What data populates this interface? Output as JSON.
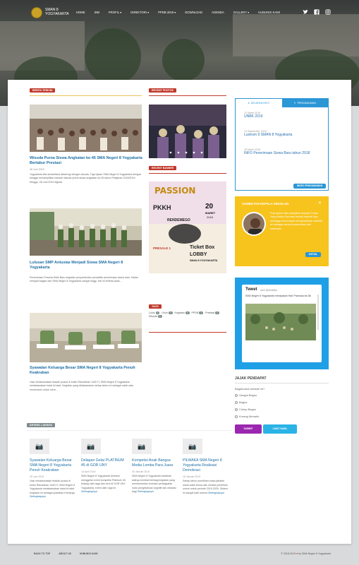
{
  "header": {
    "brand_line1": "SMAN 8",
    "brand_line2": "YOGYAKARTA",
    "menu": [
      "HOME",
      "SIM",
      "PROFIL ▾",
      "DIREKTORI ▾",
      "PPDB 2019 ▾",
      "DOWNLOAD",
      "AGENDA",
      "GALLERY ▾",
      "HUBUNGI KAMI"
    ],
    "social_icons": [
      "twitter-icon",
      "facebook-icon",
      "instagram-icon"
    ]
  },
  "sections": {
    "berita": "BERITA TERKINI",
    "recent_photos": "RECENT PHOTOS",
    "recent_banner": "RECENT BANNER",
    "tags": "TAGS",
    "artikel": "ARTIKEL LAINNYA"
  },
  "posts": [
    {
      "title": "Wisuda Purna Siswa Angkatan ke-45 SMA Negeri 8 Yogyakarta Bertabur Prestasi",
      "meta": "08 Juni 2019",
      "excerpt": "Yogyakarta kita senantiasa dibarengi dengan wisuda. Tiga tujuan SMA Negeri 8 Yogyakarta dengan bangga menampilkan barisan wisuda purna siswa angkatan ke-45 tahun Pelajaran 2018/2019. Minggu, 28 Juni 2019 digelar."
    },
    {
      "title": "Lulusan SMP Antusias Menjadi Siswa SMA Negeri 8 Yogyakarta",
      "meta": "",
      "excerpt": "Penerimaan Peserta Didik Baru kegiatan penyambutan pendaftar penerimaan siswa baru. Kalian menjadi bagian dari SMA Negeri 8 Yogyakarta sangat tinggi. Hal ini terlihat pada..."
    },
    {
      "title": "Syawalan Keluarga Besar SMA Negeri 8 Yogyakarta Penuh Keakraban",
      "meta": "",
      "excerpt": "Usai melaksanakan ibadah puasa di bulan Ramadhan 1440 H, SMA Negeri 8 Yogyakarta melaksanakan halal bi halal. Kegiatan yang dilaksanakan setiap tahun ini sebagai salah satu momentum untuk mem..."
    }
  ],
  "tabbox": {
    "tab1": "DELAPAN INFO",
    "tab2": "PENGUMUMAN",
    "items": [
      {
        "date": "22 Maret 2019",
        "title": "UNBK 2019"
      },
      {
        "date": "14 September 2018",
        "title": "Lustrum 9 SMAN 8 Yogyakarta"
      },
      {
        "date": "28 Maret 2018",
        "title": "INFO Penerimaan Siswa Baru tahun 2018"
      }
    ],
    "more": "INDEX PENGUMUMAN"
  },
  "welcome": {
    "title": "SAMBUTAN KEPALA SEKOLAH",
    "close": "✕",
    "text": "Puji syukur kita panjatkan kepada Tuhan Yang Maha Esa atas berkat rahmat-Nya sehingga kami dapat menghadirkan website ini sebagai sarana komunikasi dan informasi...",
    "button": "DETAIL"
  },
  "tweet": {
    "label": "Tweet",
    "handle": "oleh @sma8yk",
    "text": "SMA Negeri 8 Yogyakarta merayakan Hari Pramuka ke-58"
  },
  "poll": {
    "title": "JAJAK PENDAPAT",
    "question": "Bagaimana website ini?",
    "options": [
      "Sangat Bagus",
      "Bagus",
      "Cukup Bagus",
      "Kurang Menarik"
    ],
    "vote": "SUBMIT",
    "results": "LIHAT HASIL"
  },
  "tags": [
    {
      "name": "Lulus",
      "count": "2"
    },
    {
      "name": "Ulum",
      "count": "3"
    },
    {
      "name": "Kegiatan",
      "count": "4"
    },
    {
      "name": "PPDB",
      "count": "1"
    },
    {
      "name": "Prestasi",
      "count": "2"
    },
    {
      "name": "Wisuda",
      "count": "1"
    }
  ],
  "banner": {
    "line1": "PASSION",
    "line2": "PKKH",
    "line3": "RENDEMEGO",
    "day": "20",
    "month": "MARET",
    "year": "2018",
    "presale": "PRESALE 1",
    "ticket": "Ticket Box",
    "lobby": "LOBBY",
    "venue": "SMAN 8 YOGYAKARTA"
  },
  "bottom_posts": [
    {
      "title": "Syawalan Keluarga Besar SMA Negeri 8 Yogyakarta Penuh Keakraban",
      "date": "28 Juni 2019",
      "excerpt": "Usai melaksanakan ibadah puasa di bulan Ramadhan 1440 H, SMA Negeri 8 Yogyakarta melaksanakan halal bi halal. Kegiatan ini sebagai syawalan Keluarga",
      "more": "Selengkapnya"
    },
    {
      "title": "Delapan Gelar PLATINUM 45 di GOR UNY",
      "date": "14 April 2019",
      "excerpt": "SMA Negeri 8 Yogyakarta berhasil menggelar event kompetisi Platinum 45 bidang olah raga dan seni di GOR UNY Yogyakarta, event olah raga ini",
      "more": "Selengkapnya"
    },
    {
      "title": "Kompetisi Anak Bangsa Media Lomba Para Juara",
      "date": "26 Januari 2019",
      "excerpt": "SMA Negeri 8 Yogyakarta kesekian kalinya kembali berbagi kegiatan yang membutuhkan tuntutan peningkatan mutu pengetahuan kognitif dan edukasi bagi",
      "more": "Selengkapnya"
    },
    {
      "title": "PILWAKA SMA Negeri 8 Yogyakarta Realisasi Demokrasi",
      "date": "18 Januari 2019",
      "excerpt": "Setiap tahun pemilihan masa jabatan untuk wakil ketua osis melalui pemilihan umum untuk periode 2019-2020. Sistem ini sangat baik karena",
      "more": "Selengkapnya"
    }
  ],
  "footer": {
    "links": [
      "BACK TO TOP",
      "ABOUT US",
      "HUBUNGI KAMI"
    ],
    "copy_prefix": "© 2018-2019",
    "heart": "♥",
    "copy_by": "by",
    "copy_suffix": "SMA Negeri 8 Yogyakarta"
  },
  "colors": {
    "accent_blue": "#2b97d5",
    "accent_red": "#c0392b",
    "welcome_yellow": "#f7c31d",
    "twitter_blue": "#1fa0e6",
    "link_blue": "#1d6fa5"
  }
}
